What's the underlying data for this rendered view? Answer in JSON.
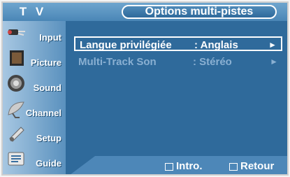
{
  "header": {
    "app_title": "T V",
    "menu_title": "Options multi-pistes"
  },
  "sidebar": {
    "items": [
      {
        "label": "Input",
        "icon": "input-plug-icon"
      },
      {
        "label": "Picture",
        "icon": "picture-icon"
      },
      {
        "label": "Sound",
        "icon": "speaker-icon"
      },
      {
        "label": "Channel",
        "icon": "satellite-dish-icon"
      },
      {
        "label": "Setup",
        "icon": "setup-icon"
      },
      {
        "label": "Guide",
        "icon": "guide-program-icon"
      }
    ]
  },
  "options": [
    {
      "name": "Langue privilégiée",
      "value": ": Anglais",
      "arrow": "►"
    },
    {
      "name": "Multi-Track Son",
      "value": ": Stéréo",
      "arrow": "►"
    }
  ],
  "footer": {
    "enter_label": "Intro.",
    "return_label": "Retour"
  },
  "colors": {
    "background": "#2f6a9b",
    "text_active": "#ffffff",
    "text_inactive": "#8ab0d2"
  }
}
